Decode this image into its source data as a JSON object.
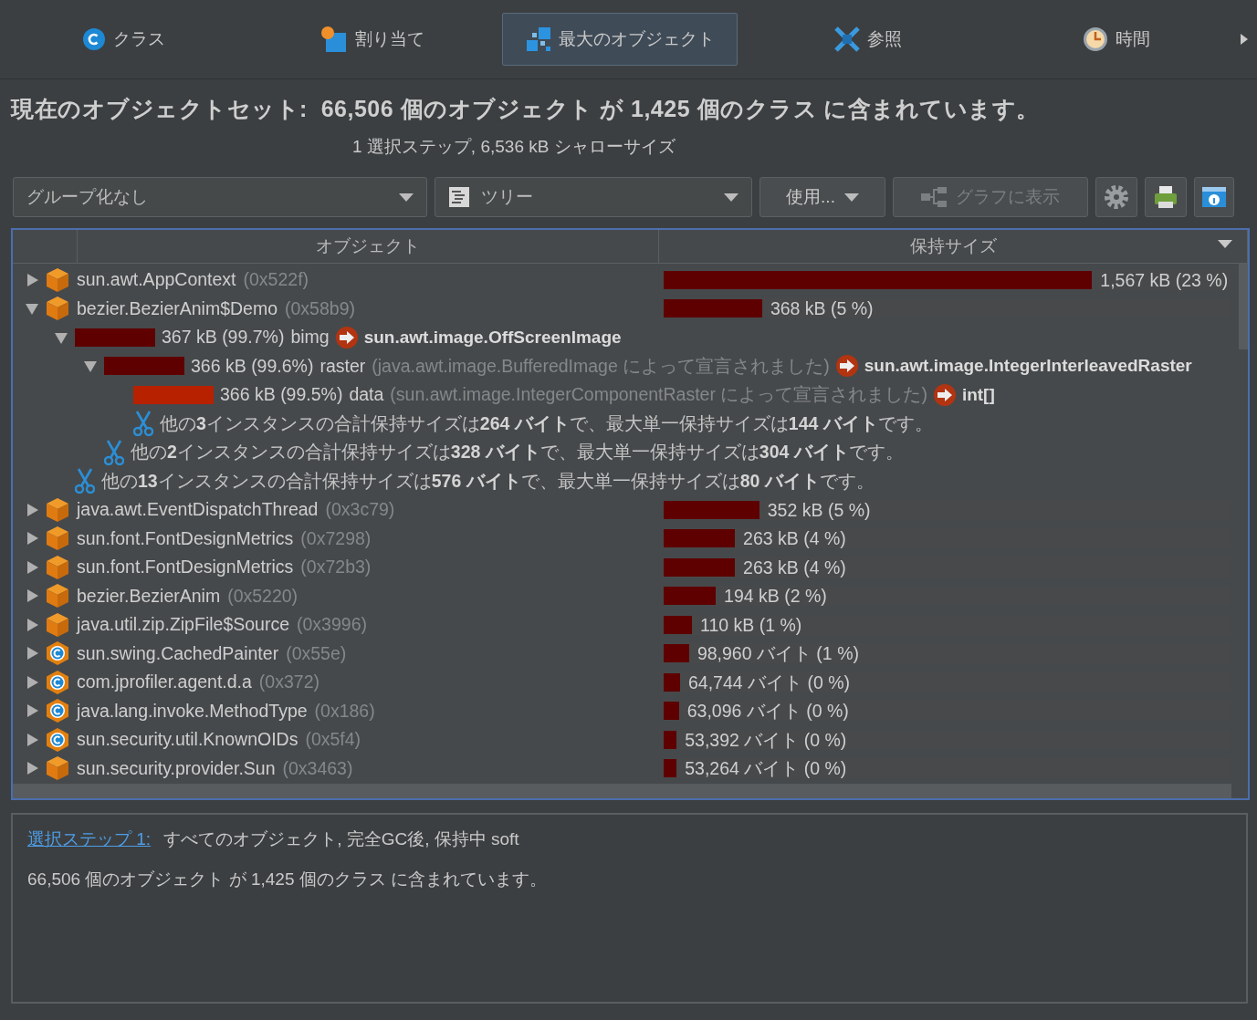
{
  "tabs": [
    {
      "label": "クラス",
      "selected": false
    },
    {
      "label": "割り当て",
      "selected": false
    },
    {
      "label": "最大のオブジェクト",
      "selected": true
    },
    {
      "label": "参照",
      "selected": false
    },
    {
      "label": "時間",
      "selected": false
    }
  ],
  "heading": "現在のオブジェクトセット:  66,506 個のオブジェクト が 1,425 個のクラス に含まれています。",
  "subheading": "1 選択ステップ, 6,536 kB シャローサイズ",
  "toolbar": {
    "grouping": {
      "value": "グループ化なし"
    },
    "view": {
      "value": "ツリー"
    },
    "use_button": "使用...",
    "graph_button": {
      "label": "グラフに表示",
      "disabled": true
    }
  },
  "table": {
    "columns": [
      "オブジェクト",
      "保持サイズ"
    ],
    "rows": [
      {
        "kind": "object",
        "expanded": false,
        "name": "sun.awt.AppContext",
        "address": "(0x522f)",
        "level": 0.757,
        "size": "1,567 kB (23 %)"
      },
      {
        "kind": "object",
        "expanded": true,
        "name": "bezier.BezierAnim$Demo",
        "address": "(0x58b9)",
        "level": 0.174,
        "size": "368 kB (5 %)",
        "children": [
          {
            "kind": "ref",
            "expanded": true,
            "highlighted": false,
            "size": "367 kB (99.7%)",
            "field": "bimg",
            "target": "sun.awt.image.OffScreenImage",
            "children": [
              {
                "kind": "ref",
                "expanded": true,
                "highlighted": false,
                "size": "366 kB (99.6%)",
                "field": "raster",
                "declared": "(java.awt.image.BufferedImage によって宣言されました)",
                "target": "sun.awt.image.IntegerInterleavedRaster",
                "children": [
                  {
                    "kind": "ref",
                    "highlighted": true,
                    "size": "366 kB (99.5%)",
                    "field": "data",
                    "declared": "(sun.awt.image.IntegerComponentRaster によって宣言されました)",
                    "target": "int[]"
                  },
                  {
                    "kind": "more",
                    "text": "他の**3**インスタンスの合計保持サイズは**264 バイト**で、最大単一保持サイズは**144 バイト**です。"
                  }
                ]
              },
              {
                "kind": "more",
                "text": "他の**2**インスタンスの合計保持サイズは**328 バイト**で、最大単一保持サイズは**304 バイト**です。"
              }
            ]
          },
          {
            "kind": "more",
            "text": "他の**13**インスタンスの合計保持サイズは**576 バイト**で、最大単一保持サイズは**80 バイト**です。"
          }
        ]
      },
      {
        "kind": "object",
        "expanded": false,
        "name": "java.awt.EventDispatchThread",
        "address": "(0x3c79)",
        "level": 0.169,
        "size": "352 kB (5 %)"
      },
      {
        "kind": "object",
        "expanded": false,
        "name": "sun.font.FontDesignMetrics",
        "address": "(0x7298)",
        "level": 0.126,
        "size": "263 kB (4 %)"
      },
      {
        "kind": "object",
        "expanded": false,
        "name": "sun.font.FontDesignMetrics",
        "address": "(0x72b3)",
        "level": 0.126,
        "size": "263 kB (4 %)"
      },
      {
        "kind": "object",
        "expanded": false,
        "name": "bezier.BezierAnim",
        "address": "(0x5220)",
        "level": 0.092,
        "size": "194 kB (2 %)"
      },
      {
        "kind": "object",
        "expanded": false,
        "name": "java.util.zip.ZipFile$Source",
        "address": "(0x3996)",
        "level": 0.05,
        "size": "110 kB (1 %)"
      },
      {
        "kind": "class",
        "expanded": false,
        "name": "sun.swing.CachedPainter",
        "address": "(0x55e)",
        "level": 0.045,
        "size": "98,960 バイト (1 %)"
      },
      {
        "kind": "class",
        "expanded": false,
        "name": "com.jprofiler.agent.d.a",
        "address": "(0x372)",
        "level": 0.029,
        "size": "64,744 バイト (0 %)"
      },
      {
        "kind": "class",
        "expanded": false,
        "name": "java.lang.invoke.MethodType",
        "address": "(0x186)",
        "level": 0.027,
        "size": "63,096 バイト (0 %)"
      },
      {
        "kind": "class",
        "expanded": false,
        "name": "sun.security.util.KnownOIDs",
        "address": "(0x5f4)",
        "level": 0.023,
        "size": "53,392 バイト (0 %)"
      },
      {
        "kind": "object",
        "expanded": false,
        "name": "sun.security.provider.Sun",
        "address": "(0x3463)",
        "level": 0.023,
        "size": "53,264 バイト (0 %)"
      }
    ]
  },
  "details": {
    "link": "選択ステップ 1:",
    "description": "すべてのオブジェクト, 完全GC後, 保持中 soft",
    "summary": "66,506 個のオブジェクト が 1,425 個のクラス に含まれています。"
  }
}
